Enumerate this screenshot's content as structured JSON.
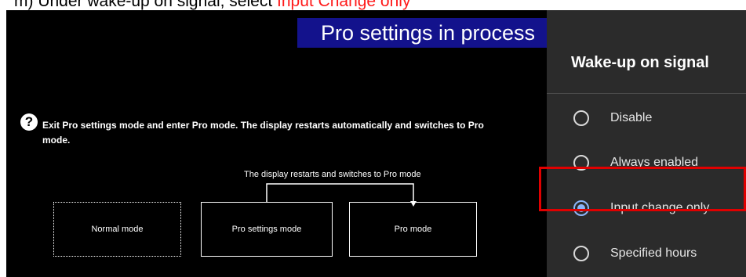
{
  "instruction": {
    "prefix": "m) Under wake-up on signal, select ",
    "highlight": "Input Change only",
    "highlight_color": "#ff1a1a"
  },
  "banner": {
    "text": "Pro settings in process",
    "color": "#13128c"
  },
  "help": {
    "icon": "question-icon",
    "text": "Exit Pro settings mode and enter Pro mode. The display restarts automatically and switches to Pro mode."
  },
  "flow": {
    "caption": "The display restarts and switches to Pro mode",
    "modes": [
      {
        "label": "Normal mode",
        "style": "dotted"
      },
      {
        "label": "Pro settings mode",
        "style": "solid"
      },
      {
        "label": "Pro mode",
        "style": "solid"
      }
    ]
  },
  "panel": {
    "title": "Wake-up on signal",
    "selected_color": "#8ab4f8",
    "options": [
      {
        "label": "Disable",
        "selected": false
      },
      {
        "label": "Always enabled",
        "selected": false
      },
      {
        "label": "Input change only",
        "selected": true
      },
      {
        "label": "Specified hours",
        "selected": false
      }
    ],
    "highlight_color": "#e00000"
  }
}
